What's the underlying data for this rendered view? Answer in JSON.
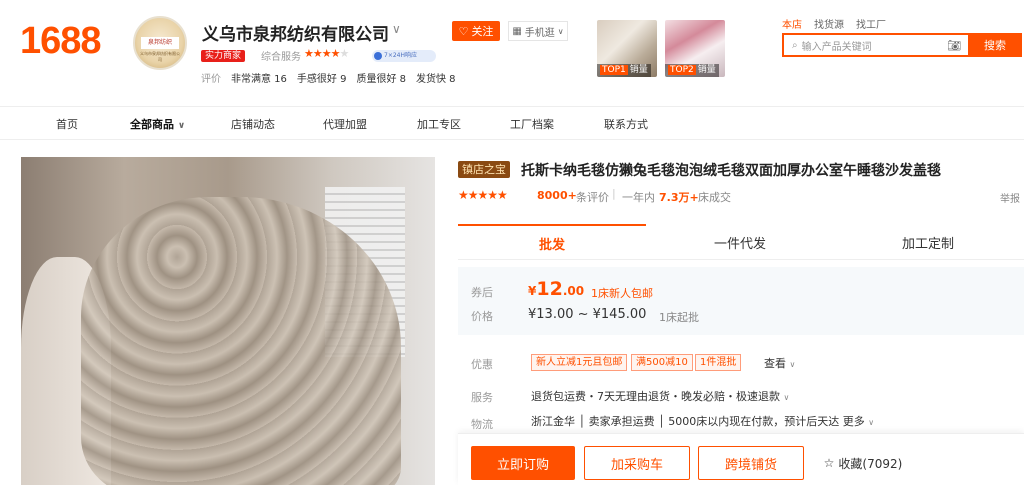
{
  "header": {
    "logo": "1688",
    "shop_name": "义乌市泉邦纺织有限公司",
    "avatar_text": "泉邦纺织",
    "avatar_sub": "义乌市泉邦纺织有限公司",
    "follow_label": "关注",
    "mobile_label": "手机逛",
    "strength_badge": "实力商家",
    "service_label": "综合服务",
    "service_stars_full": "★★★★",
    "service_stars_empty": "★",
    "service_pill": "7×24H响应",
    "eval_label": "评价",
    "eval_items": [
      "非常满意 16",
      "手感很好 9",
      "质量很好 8",
      "发货快 8"
    ]
  },
  "top_items": [
    {
      "rank": "TOP1",
      "label": "销量"
    },
    {
      "rank": "TOP2",
      "label": "销量"
    }
  ],
  "search": {
    "tabs": [
      "本店",
      "找货源",
      "找工厂"
    ],
    "placeholder": "输入产品关键词",
    "button": "搜索"
  },
  "nav": {
    "items": [
      "首页",
      "全部商品",
      "店铺动态",
      "代理加盟",
      "加工专区",
      "工厂档案",
      "联系方式"
    ]
  },
  "product": {
    "badge": "镇店之宝",
    "title": "托斯卡纳毛毯仿獭兔毛毯泡泡绒毛毯双面加厚办公室午睡毯沙发盖毯",
    "stars": "★★★★★",
    "review_count": "8000+",
    "review_label": "条评价",
    "year_label": "一年内",
    "deal_count": "7.3万+",
    "deal_label": "床成交",
    "report": "举报"
  },
  "buy_tabs": [
    "批发",
    "一件代发",
    "加工定制"
  ],
  "price": {
    "coupon_label": "券后",
    "coupon_currency": "¥",
    "coupon_int": "12",
    "coupon_dec": ".00",
    "new_user_tip": "1床新人包邮",
    "price_label": "价格",
    "range": "¥13.00  ~  ¥145.00",
    "min_order": "1床起批"
  },
  "promo": {
    "label": "优惠",
    "tags": [
      "新人立减1元且包邮",
      "满500减10",
      "1件混批"
    ],
    "view": "查看"
  },
  "service": {
    "label": "服务",
    "text": "退货包运费・7天无理由退货・晚发必赔・极速退款"
  },
  "shipping": {
    "label": "物流",
    "text": "浙江金华 │ 卖家承担运费 │ 5000床以内现在付款，预计后天达 更多"
  },
  "actions": {
    "order": "立即订购",
    "cart": "加采购车",
    "cross": "跨境铺货",
    "favorite": "收藏(7092)"
  },
  "colors": {
    "accent": "#ff5000",
    "badge_brown": "#8a4a12",
    "strength_red": "#e8201a",
    "price_bg": "#f6f9fb"
  }
}
